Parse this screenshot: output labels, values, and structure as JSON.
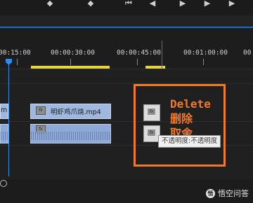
{
  "toolbar": {
    "icons": [
      "marker-icon",
      "diamond-icon",
      "step-back-icon",
      "play-icon",
      "step-forward-icon",
      "stop-icon"
    ]
  },
  "timeline": {
    "time_ticks": [
      "00:15:00",
      "00:00:30:00",
      "00:00:45:00",
      "00:01:00:00",
      "00"
    ],
    "playhead_color": "#2d8cf0",
    "work_area_color": "#e8d53a"
  },
  "tracks": {
    "video_clips": [
      {
        "label": "mp"
      },
      {
        "label": "明虾鸡爪烧.mp4"
      }
    ],
    "audio_clips": [
      {
        "label": ""
      },
      {
        "label": ""
      }
    ]
  },
  "annotation": {
    "line1": "Delete",
    "line2": "删除",
    "line3": "取舍",
    "color": "#f07a2c"
  },
  "tooltip": {
    "text": "不透明度:不透明度"
  },
  "watermark": {
    "text": "悟空问答"
  }
}
